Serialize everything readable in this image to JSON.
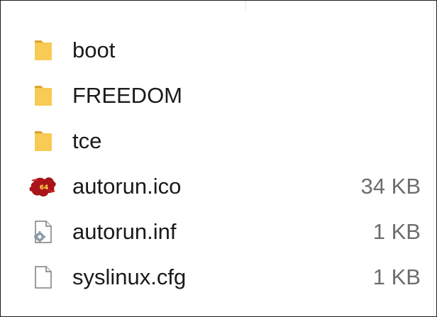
{
  "files": [
    {
      "name": "boot",
      "size": "",
      "type": "folder",
      "icon": "folder-icon"
    },
    {
      "name": "FREEDOM",
      "size": "",
      "type": "folder",
      "icon": "folder-icon"
    },
    {
      "name": "tce",
      "size": "",
      "type": "folder",
      "icon": "folder-icon"
    },
    {
      "name": "autorun.ico",
      "size": "34 KB",
      "type": "icon-file",
      "icon": "puzzle-64-icon"
    },
    {
      "name": "autorun.inf",
      "size": "1 KB",
      "type": "settings-file",
      "icon": "settings-file-icon"
    },
    {
      "name": "syslinux.cfg",
      "size": "1 KB",
      "type": "text-file",
      "icon": "blank-file-icon"
    }
  ],
  "colors": {
    "folder": "#f3c74f",
    "folder_dark": "#dba42f",
    "puzzle": "#a9141a",
    "puzzle_text": "#ffd84a",
    "file_border": "#7d7d7d",
    "name_text": "#1a1a1a",
    "size_text": "#6d6d6d"
  }
}
